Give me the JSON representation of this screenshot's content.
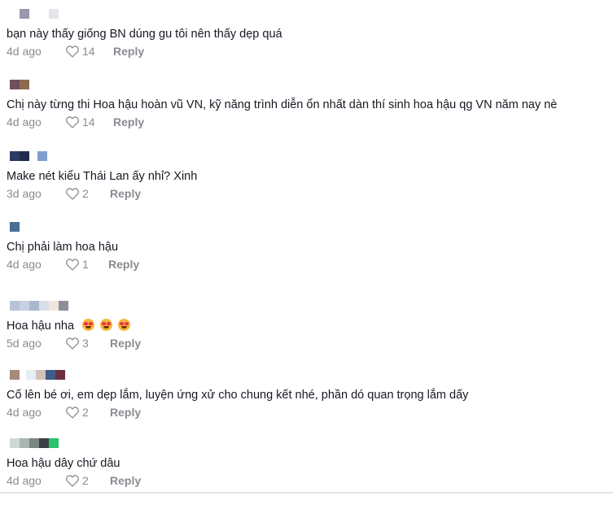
{
  "comments": [
    {
      "text": "bạn này thấy giống BN dúng gu tôi nên thấy dẹp quá",
      "time": "4d ago",
      "likes": "14",
      "reply": "Reply",
      "name_blocks": [
        "#9a98b0",
        "#ffffff",
        "#e6e4ea"
      ]
    },
    {
      "text": "Chị này từng thi Hoa hậu hoàn vũ VN, kỹ năng trình diễn ổn nhất dàn thí sinh hoa hậu qg VN năm nay nè",
      "time": "4d ago",
      "likes": "14",
      "reply": "Reply",
      "name_blocks": [
        "#6f4f5e",
        "#8e6b4e"
      ]
    },
    {
      "text": "Make nét kiểu Thái Lan ấy nhỉ? Xinh",
      "time": "3d ago",
      "likes": "2",
      "reply": "Reply",
      "name_blocks": [
        "#2d3a63",
        "#1f2a4e",
        "#ffffff",
        "#7f9fcf"
      ]
    },
    {
      "text": "Chị phải làm hoa hậu",
      "time": "4d ago",
      "likes": "1",
      "reply": "Reply",
      "name_blocks": [
        "#4a6e95"
      ]
    },
    {
      "text": "Hoa hậu nha",
      "emoji": [
        "smiling-face-with-heart-eyes",
        "smiling-face-with-heart-eyes",
        "smiling-face-with-heart-eyes"
      ],
      "time": "5d ago",
      "likes": "3",
      "reply": "Reply",
      "name_blocks": [
        "#b7c3d8",
        "#c7d0e0",
        "#a9b8cf",
        "#d9dde7",
        "#f1e6da",
        "#8b8e99"
      ]
    },
    {
      "text": "Cố lên bé ơi, em dẹp lắm, luyện ứng xử cho chung kết nhé, phần dó quan trọng lắm dấy",
      "time": "4d ago",
      "likes": "2",
      "reply": "Reply",
      "name_blocks": [
        "#a78a78",
        "#ffffff",
        "#e5eef4",
        "#d2c1b5",
        "#3e5d87",
        "#6a2f3f"
      ]
    },
    {
      "text": "Hoa hậu dây chứ dâu",
      "time": "4d ago",
      "likes": "2",
      "reply": "Reply",
      "name_blocks": [
        "#cfd8d4",
        "#a8b5b0",
        "#7a8480",
        "#3b3f45",
        "#27c46b"
      ]
    }
  ],
  "icons": {
    "like": "heart-outline-icon"
  },
  "colors": {
    "text": "#161823",
    "meta": "#8a8b91"
  }
}
